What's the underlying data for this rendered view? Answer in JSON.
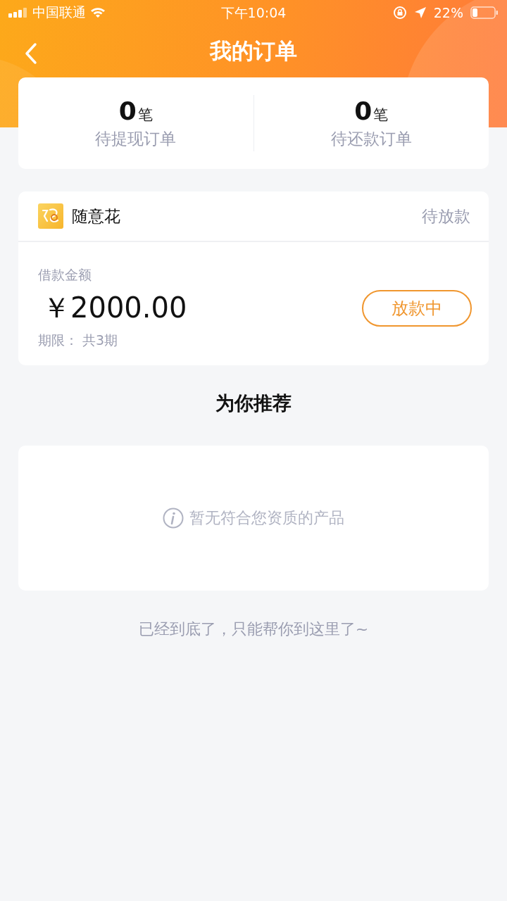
{
  "status_bar": {
    "carrier": "中国联通",
    "time": "下午10:04",
    "battery": "22%"
  },
  "nav": {
    "title": "我的订单"
  },
  "summary": [
    {
      "count": "0",
      "unit": "笔",
      "label": "待提现订单"
    },
    {
      "count": "0",
      "unit": "笔",
      "label": "待还款订单"
    }
  ],
  "order": {
    "product": "随意花",
    "status": "待放款",
    "amount_label": "借款金额",
    "amount": "￥2000.00",
    "term": "期限： 共3期",
    "action": "放款中"
  },
  "recommend": {
    "title": "为你推荐",
    "empty_text": "暂无符合您资质的产品"
  },
  "footer": "已经到底了，只能帮你到这里了~"
}
